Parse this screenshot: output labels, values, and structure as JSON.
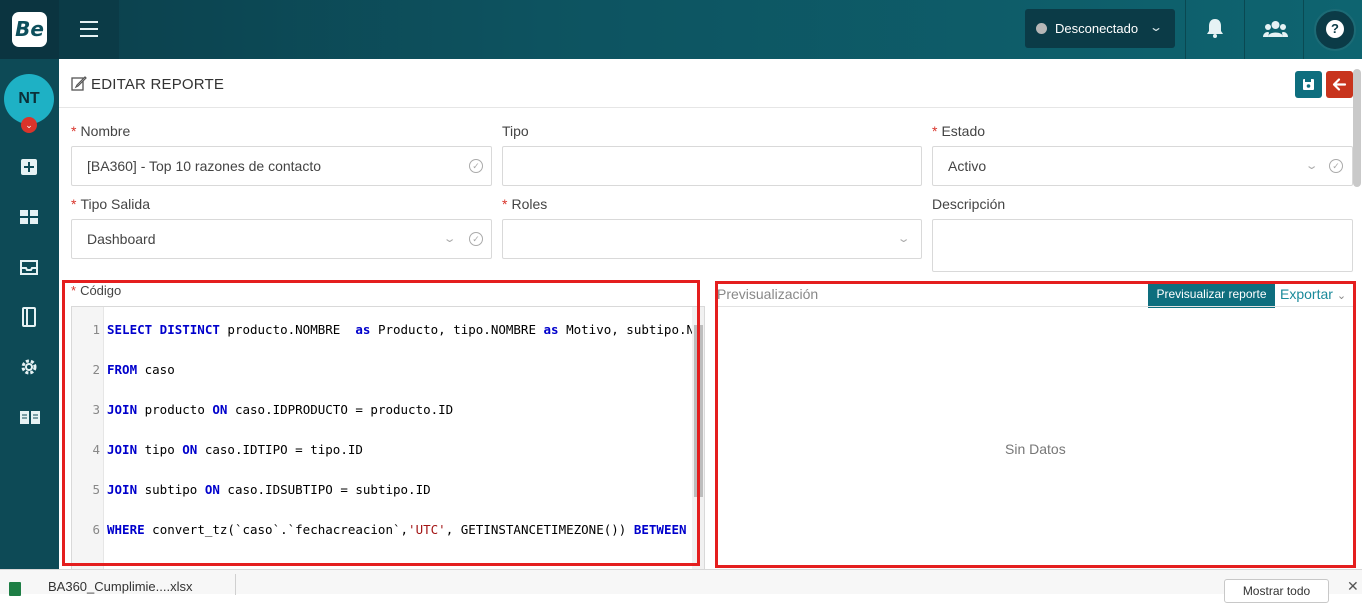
{
  "topbar": {
    "logo_text": "Be",
    "status_label": "Desconectado",
    "status_color": "#b7b7b7",
    "help_label": "?"
  },
  "sidebar": {
    "avatar_initials": "NT",
    "items": [
      "plus-square-icon",
      "dashboard-icon",
      "inbox-icon",
      "notebook-icon",
      "gear-icon",
      "book-icon"
    ]
  },
  "page": {
    "title": "EDITAR REPORTE"
  },
  "form": {
    "required_mark": "*",
    "nombre": {
      "label": "Nombre",
      "value": "[BA360] - Top 10 razones de contacto"
    },
    "tipo": {
      "label": "Tipo",
      "value": ""
    },
    "estado": {
      "label": "Estado",
      "value": "Activo"
    },
    "tipo_salida": {
      "label": "Tipo Salida",
      "value": "Dashboard"
    },
    "roles": {
      "label": "Roles",
      "value": ""
    },
    "descripcion": {
      "label": "Descripción",
      "value": ""
    },
    "codigo": {
      "label": "Código"
    }
  },
  "code": {
    "lines": [
      {
        "n": "1",
        "parts": [
          [
            "kw",
            "SELECT DISTINCT"
          ],
          [
            "t",
            " producto.NOMBRE  "
          ],
          [
            "kw",
            "as"
          ],
          [
            "t",
            " Producto, tipo.NOMBRE "
          ],
          [
            "kw",
            "as"
          ],
          [
            "t",
            " Motivo, subtipo.NOMBRE "
          ]
        ]
      },
      {
        "n": "",
        "parts": []
      },
      {
        "n": "2",
        "parts": [
          [
            "kw",
            "FROM"
          ],
          [
            "t",
            " caso"
          ]
        ]
      },
      {
        "n": "",
        "parts": []
      },
      {
        "n": "3",
        "parts": [
          [
            "kw",
            "JOIN"
          ],
          [
            "t",
            " producto "
          ],
          [
            "kw",
            "ON"
          ],
          [
            "t",
            " caso.IDPRODUCTO = producto.ID"
          ]
        ]
      },
      {
        "n": "",
        "parts": []
      },
      {
        "n": "4",
        "parts": [
          [
            "kw",
            "JOIN"
          ],
          [
            "t",
            " tipo "
          ],
          [
            "kw",
            "ON"
          ],
          [
            "t",
            " caso.IDTIPO = tipo.ID"
          ]
        ]
      },
      {
        "n": "",
        "parts": []
      },
      {
        "n": "5",
        "parts": [
          [
            "kw",
            "JOIN"
          ],
          [
            "t",
            " subtipo "
          ],
          [
            "kw",
            "ON"
          ],
          [
            "t",
            " caso.IDSUBTIPO = subtipo.ID"
          ]
        ]
      },
      {
        "n": "",
        "parts": []
      },
      {
        "n": "6",
        "parts": [
          [
            "kw",
            "WHERE"
          ],
          [
            "t",
            " convert_tz(`caso`.`fechacreacion`,"
          ],
          [
            "str",
            "'UTC'"
          ],
          [
            "t",
            ", GETINSTANCETIMEZONE()) "
          ],
          [
            "kw",
            "BETWEEN"
          ]
        ]
      }
    ]
  },
  "preview": {
    "label": "Previsualización",
    "preview_button": "Previsualizar reporte",
    "export_button": "Exportar",
    "empty_text": "Sin Datos"
  },
  "downloads": {
    "file_name": "BA360_Cumplimie....xlsx",
    "show_all": "Mostrar todo"
  },
  "colors": {
    "topbar": "#0d5360",
    "sidebar": "#0d4a56",
    "primary_button": "#0e6e7e",
    "back_button": "#c8341d",
    "highlight": "#e41e1e"
  }
}
